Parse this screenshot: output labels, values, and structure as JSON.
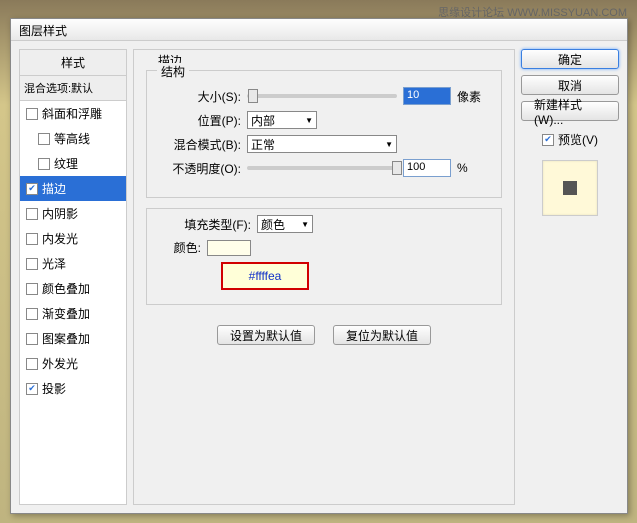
{
  "watermark": "思缘设计论坛  WWW.MISSYUAN.COM",
  "dialog_title": "图层样式",
  "left": {
    "header": "样式",
    "blend": "混合选项:默认",
    "items": [
      {
        "label": "斜面和浮雕",
        "checked": false,
        "indent": false
      },
      {
        "label": "等高线",
        "checked": false,
        "indent": true
      },
      {
        "label": "纹理",
        "checked": false,
        "indent": true
      },
      {
        "label": "描边",
        "checked": true,
        "indent": false,
        "selected": true
      },
      {
        "label": "内阴影",
        "checked": false,
        "indent": false
      },
      {
        "label": "内发光",
        "checked": false,
        "indent": false
      },
      {
        "label": "光泽",
        "checked": false,
        "indent": false
      },
      {
        "label": "颜色叠加",
        "checked": false,
        "indent": false
      },
      {
        "label": "渐变叠加",
        "checked": false,
        "indent": false
      },
      {
        "label": "图案叠加",
        "checked": false,
        "indent": false
      },
      {
        "label": "外发光",
        "checked": false,
        "indent": false
      },
      {
        "label": "投影",
        "checked": true,
        "indent": false
      }
    ]
  },
  "middle": {
    "section_label": "描边",
    "structure": {
      "legend": "结构",
      "size_label": "大小(S):",
      "size_value": "10",
      "size_unit": "像素",
      "size_pct": 4,
      "position_label": "位置(P):",
      "position_value": "内部",
      "blend_label": "混合模式(B):",
      "blend_value": "正常",
      "opacity_label": "不透明度(O):",
      "opacity_value": "100",
      "opacity_unit": "%",
      "opacity_pct": 100
    },
    "fill": {
      "legend_label": "填充类型(F):",
      "fill_type": "颜色",
      "color_label": "颜色:",
      "color_value": "#ffffea",
      "hex_text": "#ffffea"
    },
    "btn_default": "设置为默认值",
    "btn_reset": "复位为默认值"
  },
  "right": {
    "ok": "确定",
    "cancel": "取消",
    "new_style": "新建样式(W)...",
    "preview_label": "预览(V)",
    "preview_checked": true
  }
}
